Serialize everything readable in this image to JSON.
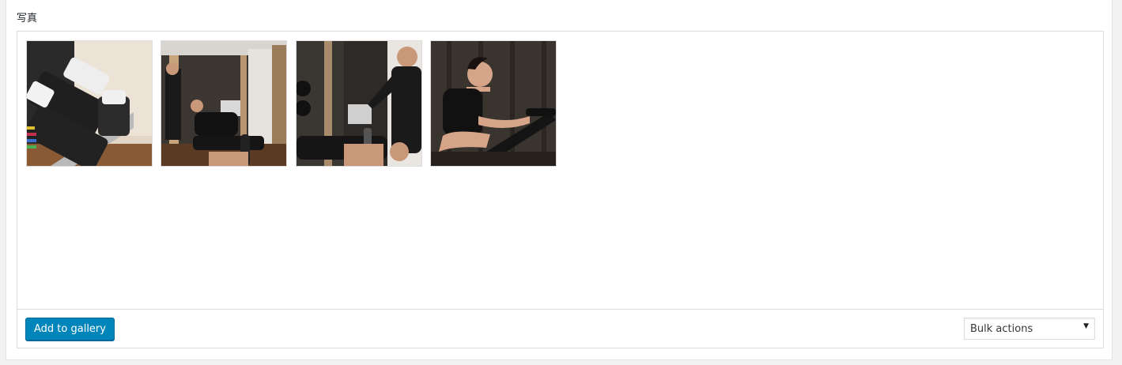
{
  "section": {
    "label": "写真"
  },
  "gallery": {
    "thumbnails": [
      {
        "alt": "dumbbells"
      },
      {
        "alt": "trainer-bench-press"
      },
      {
        "alt": "trainer-dumbbell-spot"
      },
      {
        "alt": "woman-exercise-bike"
      }
    ]
  },
  "footer": {
    "add_label": "Add to gallery",
    "bulk_selected": "Bulk actions"
  },
  "colors": {
    "primary_button": "#0085ba",
    "border": "#dddddd"
  }
}
